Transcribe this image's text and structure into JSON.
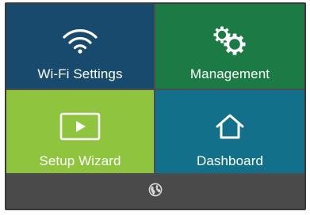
{
  "tiles": {
    "wifi": {
      "label": "Wi-Fi Settings",
      "icon": "wifi-icon",
      "color": "#174a6c"
    },
    "management": {
      "label": "Management",
      "icon": "gears-icon",
      "color": "#1c7a45"
    },
    "wizard": {
      "label": "Setup Wizard",
      "icon": "play-icon",
      "color": "#8fc43f"
    },
    "dashboard": {
      "label": "Dashboard",
      "icon": "home-icon",
      "color": "#12708a"
    }
  },
  "footer": {
    "icon": "globe-icon",
    "color": "#4a4a4a"
  }
}
